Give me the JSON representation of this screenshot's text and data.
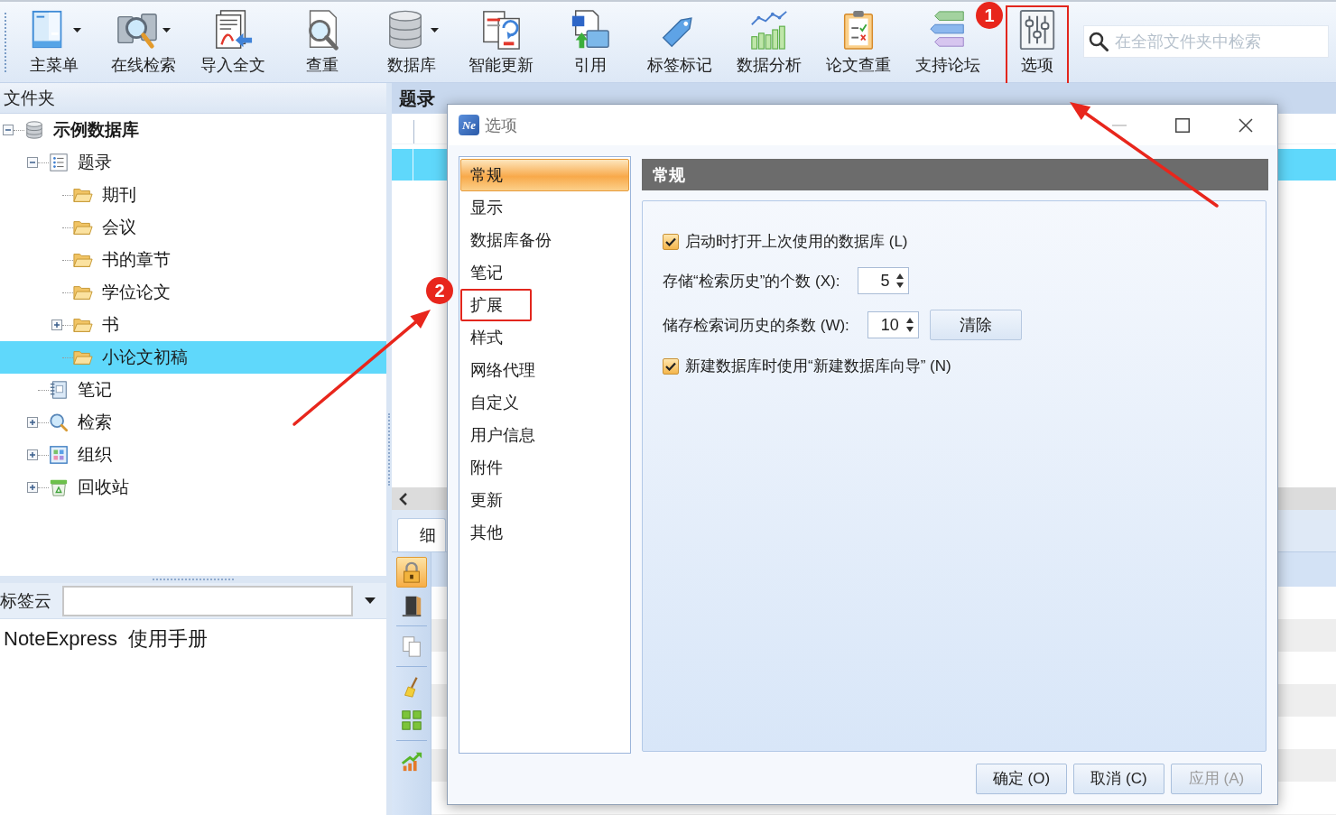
{
  "toolbar": {
    "items": [
      {
        "label": "主菜单",
        "dropdown": true,
        "marked": false
      },
      {
        "label": "在线检索",
        "dropdown": true,
        "marked": false
      },
      {
        "label": "导入全文",
        "dropdown": false,
        "marked": false
      },
      {
        "label": "查重",
        "dropdown": false,
        "marked": false
      },
      {
        "label": "数据库",
        "dropdown": true,
        "marked": false
      },
      {
        "label": "智能更新",
        "dropdown": false,
        "marked": false
      },
      {
        "label": "引用",
        "dropdown": false,
        "marked": false
      },
      {
        "label": "标签标记",
        "dropdown": false,
        "marked": false
      },
      {
        "label": "数据分析",
        "dropdown": false,
        "marked": false
      },
      {
        "label": "论文查重",
        "dropdown": false,
        "marked": false
      },
      {
        "label": "支持论坛",
        "dropdown": false,
        "marked": false
      },
      {
        "label": "选项",
        "dropdown": false,
        "marked": true
      }
    ],
    "search": {
      "placeholder": "在全部文件夹中检索"
    }
  },
  "folder_panel": {
    "title": "文件夹",
    "tree": [
      {
        "label": "示例数据库",
        "kind": "database",
        "expanded": true,
        "selected": false,
        "children": [
          {
            "label": "题录",
            "kind": "records",
            "expanded": true,
            "selected": false,
            "children": [
              {
                "label": "期刊",
                "kind": "folder",
                "selected": false
              },
              {
                "label": "会议",
                "kind": "folder",
                "selected": false
              },
              {
                "label": "书的章节",
                "kind": "folder",
                "selected": false
              },
              {
                "label": "学位论文",
                "kind": "folder",
                "selected": false
              },
              {
                "label": "书",
                "kind": "folder",
                "expanded": false,
                "selected": false
              },
              {
                "label": "小论文初稿",
                "kind": "folder",
                "selected": true
              }
            ]
          },
          {
            "label": "笔记",
            "kind": "notes",
            "selected": false
          },
          {
            "label": "检索",
            "kind": "search",
            "expanded": false,
            "selected": false
          },
          {
            "label": "组织",
            "kind": "organize",
            "expanded": false,
            "selected": false
          },
          {
            "label": "回收站",
            "kind": "trash",
            "expanded": false,
            "selected": false
          }
        ]
      }
    ]
  },
  "tag_cloud": {
    "label": "标签云"
  },
  "manual": {
    "text": "NoteExpress  使用手册"
  },
  "records_panel": {
    "title": "题录",
    "rows": [
      {
        "selected": true
      }
    ],
    "detail_tabs": [
      {
        "label": "细",
        "selected": true
      }
    ],
    "side_tools": [
      {
        "selected": true
      },
      {
        "selected": false
      },
      {
        "selected": false
      },
      {
        "selected": false
      },
      {
        "selected": false
      },
      {
        "selected": false
      }
    ]
  },
  "dialog": {
    "logo_text": "Ne",
    "title": "选项",
    "nav": [
      {
        "label": "常规",
        "selected": true,
        "marked": false
      },
      {
        "label": "显示",
        "selected": false,
        "marked": false
      },
      {
        "label": "数据库备份",
        "selected": false,
        "marked": false
      },
      {
        "label": "笔记",
        "selected": false,
        "marked": false
      },
      {
        "label": "扩展",
        "selected": false,
        "marked": true
      },
      {
        "label": "样式",
        "selected": false,
        "marked": false
      },
      {
        "label": "网络代理",
        "selected": false,
        "marked": false
      },
      {
        "label": "自定义",
        "selected": false,
        "marked": false
      },
      {
        "label": "用户信息",
        "selected": false,
        "marked": false
      },
      {
        "label": "附件",
        "selected": false,
        "marked": false
      },
      {
        "label": "更新",
        "selected": false,
        "marked": false
      },
      {
        "label": "其他",
        "selected": false,
        "marked": false
      }
    ],
    "section_title": "常规",
    "settings": [
      {
        "kind": "checkbox",
        "label": "启动时打开上次使用的数据库 (L)",
        "checked": true
      },
      {
        "kind": "spinner",
        "label": "存储“检索历史”的个数 (X):",
        "value": "5"
      },
      {
        "kind": "spinner",
        "label": "储存检索词历史的条数 (W):",
        "value": "10",
        "button": "清除"
      },
      {
        "kind": "checkbox",
        "label": "新建数据库时使用“新建数据库向导” (N)",
        "checked": true
      }
    ],
    "buttons": [
      {
        "label": "确定 (O)",
        "disabled": false
      },
      {
        "label": "取消 (C)",
        "disabled": false
      },
      {
        "label": "应用 (A)",
        "disabled": true
      }
    ]
  },
  "callouts": [
    {
      "number": "1"
    },
    {
      "number": "2"
    }
  ]
}
